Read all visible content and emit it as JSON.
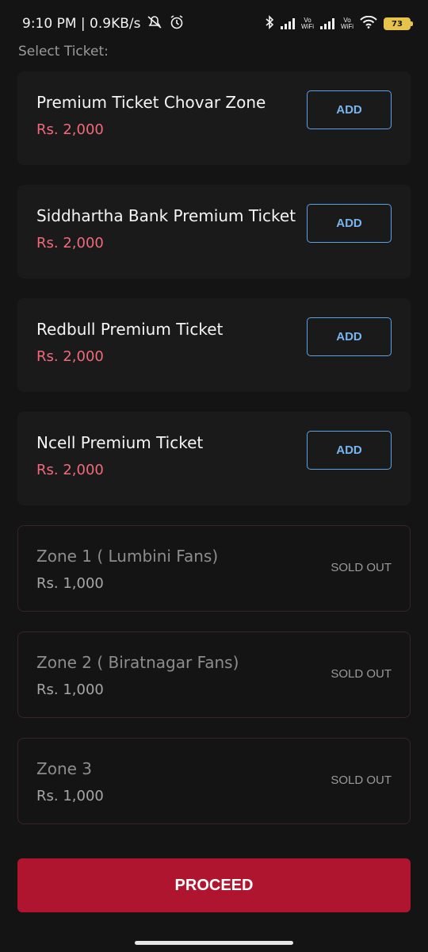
{
  "status_bar": {
    "time_speed": "9:10 PM | 0.9KB/s",
    "vowifi_1": "Vo\nWiFi",
    "vowifi_2": "Vo\nWiFi",
    "battery": "73"
  },
  "section_label": "Select Ticket:",
  "tickets": [
    {
      "name": "Premium Ticket Chovar Zone",
      "price": "Rs. 2,000",
      "action": "ADD"
    },
    {
      "name": "Siddhartha Bank Premium Ticket",
      "price": "Rs. 2,000",
      "action": "ADD"
    },
    {
      "name": "Redbull Premium Ticket",
      "price": "Rs. 2,000",
      "action": "ADD"
    },
    {
      "name": "Ncell Premium Ticket",
      "price": "Rs. 2,000",
      "action": "ADD"
    },
    {
      "name": "Zone 1 ( Lumbini Fans)",
      "price": "Rs. 1,000",
      "status": "SOLD OUT"
    },
    {
      "name": "Zone 2 ( Biratnagar Fans)",
      "price": "Rs. 1,000",
      "status": "SOLD OUT"
    },
    {
      "name": "Zone 3",
      "price": "Rs. 1,000",
      "status": "SOLD OUT"
    }
  ],
  "proceed_label": "PROCEED",
  "colors": {
    "background": "#141414",
    "price_accent": "#f06a7a",
    "add_button": "#5aa3e6",
    "proceed": "#b01530"
  },
  "icons": [
    "dnd-off-icon",
    "alarm-icon",
    "bluetooth-icon",
    "signal-icon",
    "wifi-icon",
    "battery-icon"
  ]
}
